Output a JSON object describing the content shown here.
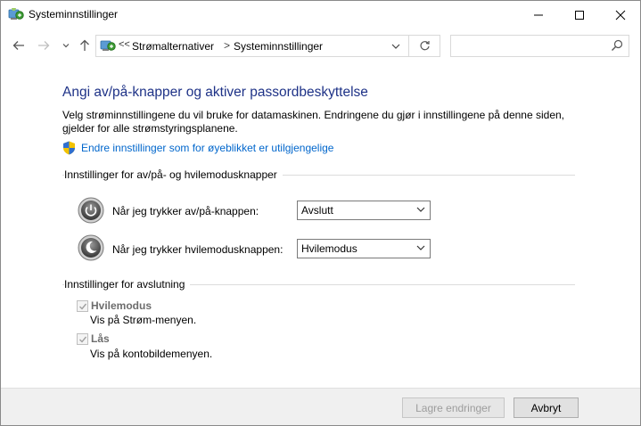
{
  "window": {
    "title": "Systeminnstillinger"
  },
  "address_bar": {
    "overflow": "<<",
    "breadcrumbs": [
      "Strømalternativer",
      "Systeminnstillinger"
    ],
    "separator": ">",
    "search_placeholder": ""
  },
  "page": {
    "heading": "Angi av/på-knapper og aktiver passordbeskyttelse",
    "description": "Velg strøminnstillingene du vil bruke for datamaskinen. Endringene du gjør i innstillingene på denne siden, gjelder for alle strømstyringsplanene.",
    "admin_link": "Endre innstillinger som for øyeblikket er utilgjengelige"
  },
  "buttons_section": {
    "title": "Innstillinger for av/på- og hvilemodusknapper",
    "rows": [
      {
        "label": "Når jeg trykker av/på-knappen:",
        "value": "Avslutt",
        "icon": "power-icon"
      },
      {
        "label": "Når jeg trykker hvilemodusknappen:",
        "value": "Hvilemodus",
        "icon": "sleep-icon"
      }
    ]
  },
  "shutdown_section": {
    "title": "Innstillinger for avslutning",
    "options": [
      {
        "label": "Hvilemodus",
        "description": "Vis på Strøm-menyen.",
        "checked": true,
        "enabled": false
      },
      {
        "label": "Lås",
        "description": "Vis på kontobildemenyen.",
        "checked": true,
        "enabled": false
      }
    ]
  },
  "footer": {
    "save_label": "Lagre endringer",
    "cancel_label": "Avbryt"
  },
  "colors": {
    "heading": "#1e3287",
    "link": "#0066cc",
    "footer_bg": "#f0f0f0"
  }
}
